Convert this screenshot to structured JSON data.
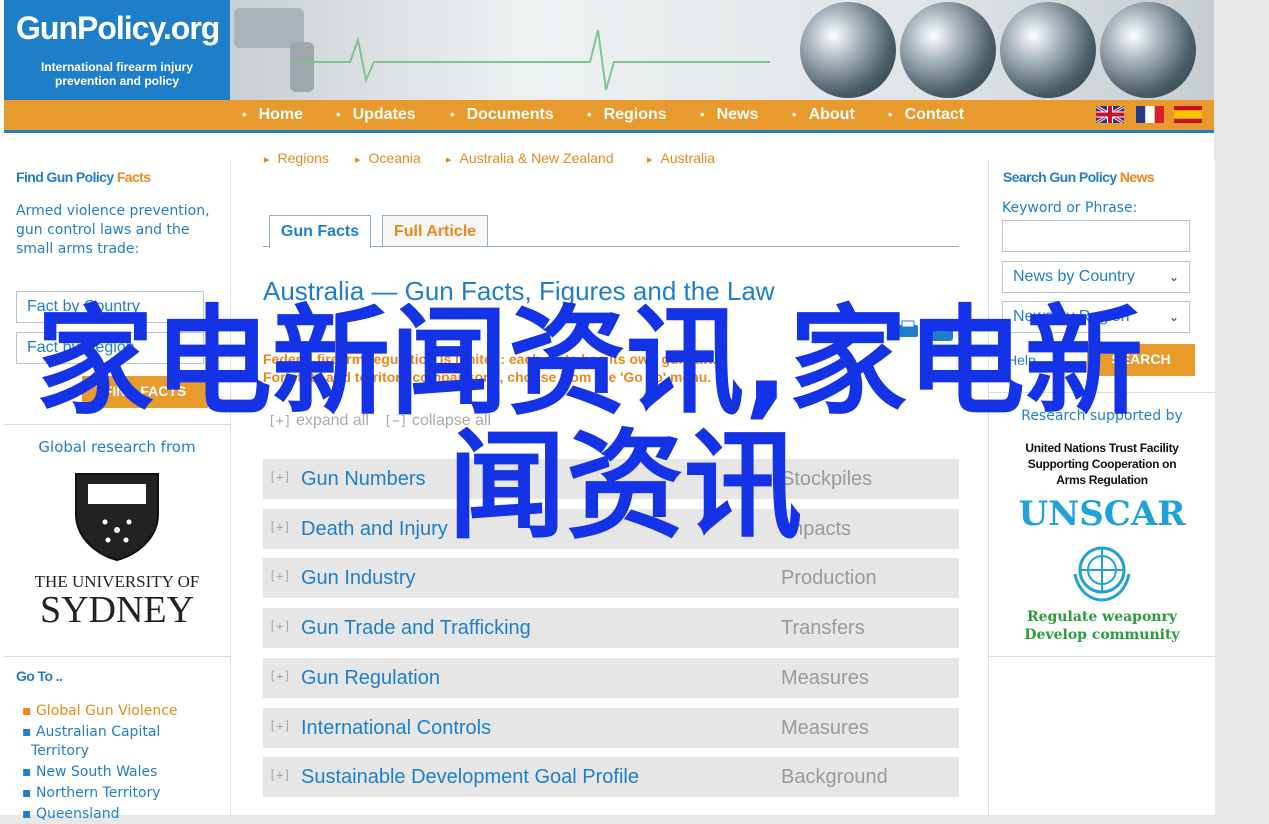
{
  "logo": {
    "name": "GunPolicy.org",
    "tagline_1": "International firearm injury",
    "tagline_2": "prevention and policy"
  },
  "nav": {
    "items": [
      "Home",
      "Updates",
      "Documents",
      "Regions",
      "News",
      "About",
      "Contact"
    ]
  },
  "breadcrumb": [
    "Regions",
    "Oceania",
    "Australia & New Zealand",
    "Australia"
  ],
  "tabs": {
    "gun_facts": "Gun Facts",
    "full_article": "Full Article"
  },
  "main": {
    "title": "Australia — Gun Facts, Figures and the Law",
    "note_1": "Federal firearm regulation is limited: each state has its own gun law.",
    "note_2": "For state and territory comparisons, choose from the 'Go To' menu.",
    "expand_all": "expand all",
    "collapse_all": "collapse all",
    "expand_mark": "[+]",
    "collapse_mark": "[−]"
  },
  "sections": [
    {
      "label": "Gun Numbers",
      "sub": "Stockpiles"
    },
    {
      "label": "Death and Injury",
      "sub": "Impacts"
    },
    {
      "label": "Gun Industry",
      "sub": "Production"
    },
    {
      "label": "Gun Trade and Trafficking",
      "sub": "Transfers"
    },
    {
      "label": "Gun Regulation",
      "sub": "Measures"
    },
    {
      "label": "International Controls",
      "sub": "Measures"
    },
    {
      "label": "Sustainable Development Goal Profile",
      "sub": "Background"
    }
  ],
  "left": {
    "find_head_1": "Find Gun Policy ",
    "find_head_2": "Facts",
    "find_desc": "Armed violence prevention, gun control laws and the small arms trade:",
    "select_country": "Fact by Country",
    "select_region": "Fact by Region",
    "find_button": "FIND FACTS",
    "global_research": "Global research from",
    "uni_line_1": "THE UNIVERSITY OF",
    "uni_line_2": "SYDNEY",
    "goto_head": "Go To ..",
    "goto_items": [
      "Global Gun Violence",
      "Australian Capital Territory",
      "New South Wales",
      "Northern Territory",
      "Queensland"
    ]
  },
  "right": {
    "search_head_1": "Search Gun Policy ",
    "search_head_2": "News",
    "keyword_label": "Keyword or Phrase:",
    "keyword_value": "",
    "select_country": "News by Country",
    "select_region": "News by Region",
    "help_label": "Help",
    "search_button": "SEARCH",
    "research_by": "Research supported by",
    "un_1": "United Nations Trust Facility",
    "un_2": "Supporting Cooperation on",
    "un_3": "Arms Regulation",
    "unscar": "UNSCAR",
    "slogan_1": "Regulate weaponry",
    "slogan_2": "Develop community"
  },
  "overlay": {
    "line_1": "家电新闻资讯,家电新",
    "line_2": "闻资讯"
  },
  "colors": {
    "blue": "#1e7fc8",
    "orange": "#e89a2c",
    "row_bg": "#e6e6e6",
    "overlay": "#1433e6"
  }
}
